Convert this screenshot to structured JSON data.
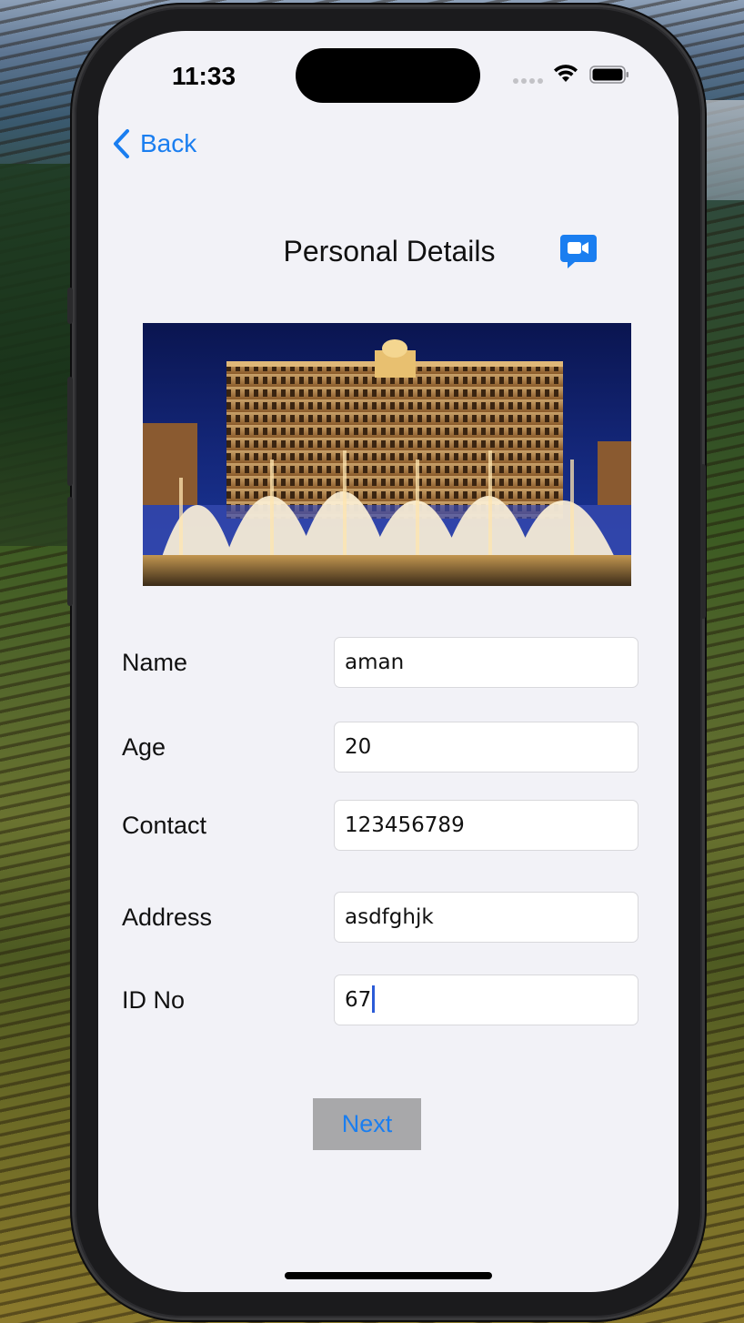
{
  "status_bar": {
    "time": "11:33"
  },
  "nav": {
    "back_label": "Back"
  },
  "header": {
    "title": "Personal Details",
    "video_icon": "video-chat-icon"
  },
  "hero_image": {
    "icon": "hotel-fountain-photo"
  },
  "form": {
    "fields": [
      {
        "label": "Name",
        "value": "aman"
      },
      {
        "label": "Age",
        "value": "20"
      },
      {
        "label": "Contact",
        "value": "123456789"
      },
      {
        "label": "Address",
        "value": "asdfghjk"
      },
      {
        "label": "ID No",
        "value": "67"
      }
    ]
  },
  "actions": {
    "next_label": "Next"
  },
  "colors": {
    "accent": "#1a7ef0",
    "screen_bg": "#f2f2f7",
    "button_bg": "#a8a8aa"
  }
}
